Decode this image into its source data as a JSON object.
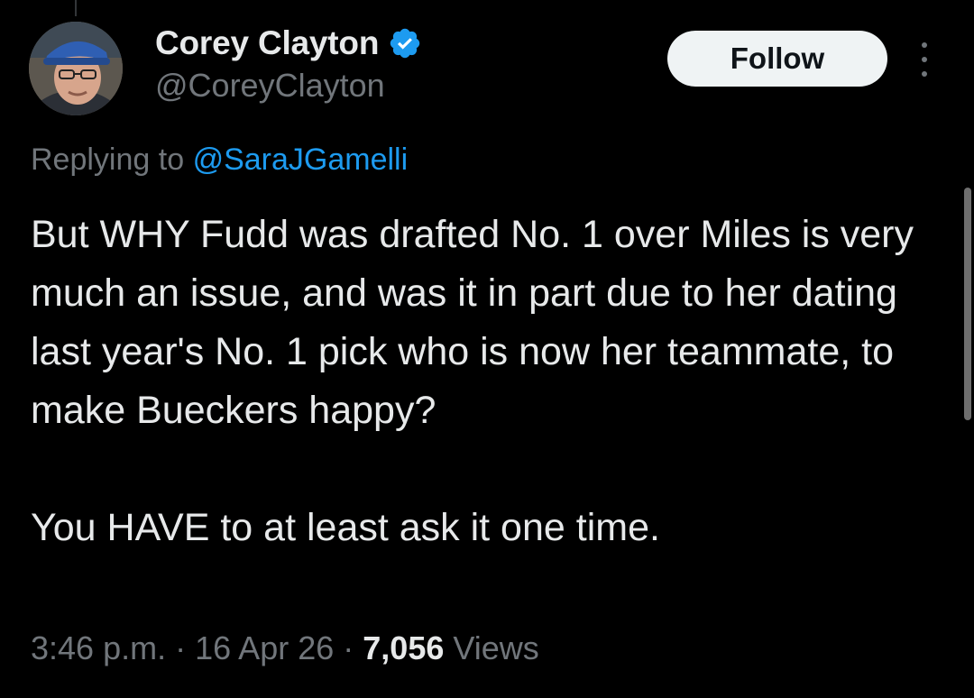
{
  "author": {
    "display_name": "Corey Clayton",
    "handle": "@CoreyClayton",
    "verified": true,
    "avatar_icon": "avatar-photo"
  },
  "header": {
    "follow_label": "Follow",
    "more_icon": "more-vertical-icon"
  },
  "reply": {
    "prefix": "Replying to",
    "mention": "@SaraJGamelli"
  },
  "tweet": {
    "paragraph_1": "But WHY Fudd was drafted No. 1 over Miles is very much an issue, and was it in part due to her dating last year's No. 1 pick who is now her teammate, to make Bueckers happy?",
    "paragraph_2": "You HAVE to at least ask it one time."
  },
  "meta": {
    "time": "3:46 p.m.",
    "separator": "·",
    "date": "16 Apr 26",
    "views_count": "7,056",
    "views_label": "Views"
  },
  "colors": {
    "background": "#000000",
    "text_primary": "#e7e9ea",
    "text_secondary": "#71767b",
    "accent_blue": "#1d9bf0",
    "follow_button_bg": "#eff3f4"
  }
}
